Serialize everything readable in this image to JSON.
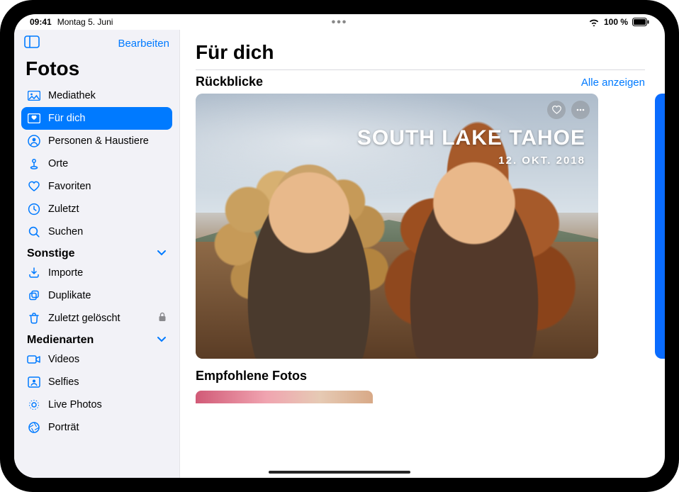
{
  "statusbar": {
    "time": "09:41",
    "date": "Montag 5. Juni",
    "battery_text": "100 %"
  },
  "sidebar": {
    "edit_label": "Bearbeiten",
    "title": "Fotos",
    "items": [
      {
        "label": "Mediathek",
        "icon": "library"
      },
      {
        "label": "Für dich",
        "icon": "foryou",
        "active": true
      },
      {
        "label": "Personen & Haustiere",
        "icon": "people"
      },
      {
        "label": "Orte",
        "icon": "places"
      },
      {
        "label": "Favoriten",
        "icon": "heart"
      },
      {
        "label": "Zuletzt",
        "icon": "clock"
      },
      {
        "label": "Suchen",
        "icon": "search"
      }
    ],
    "section_other": "Sonstige",
    "other_items": [
      {
        "label": "Importe",
        "icon": "import"
      },
      {
        "label": "Duplikate",
        "icon": "duplicates"
      },
      {
        "label": "Zuletzt gelöscht",
        "icon": "trash",
        "locked": true
      }
    ],
    "section_media": "Medienarten",
    "media_items": [
      {
        "label": "Videos",
        "icon": "video"
      },
      {
        "label": "Selfies",
        "icon": "selfie"
      },
      {
        "label": "Live Photos",
        "icon": "live"
      },
      {
        "label": "Porträt",
        "icon": "portrait"
      }
    ]
  },
  "main": {
    "title": "Für dich",
    "memories": {
      "heading": "Rückblicke",
      "see_all": "Alle anzeigen",
      "card": {
        "title": "SOUTH LAKE TAHOE",
        "date": "12. OKT. 2018"
      }
    },
    "featured": {
      "heading": "Empfohlene Fotos"
    }
  }
}
